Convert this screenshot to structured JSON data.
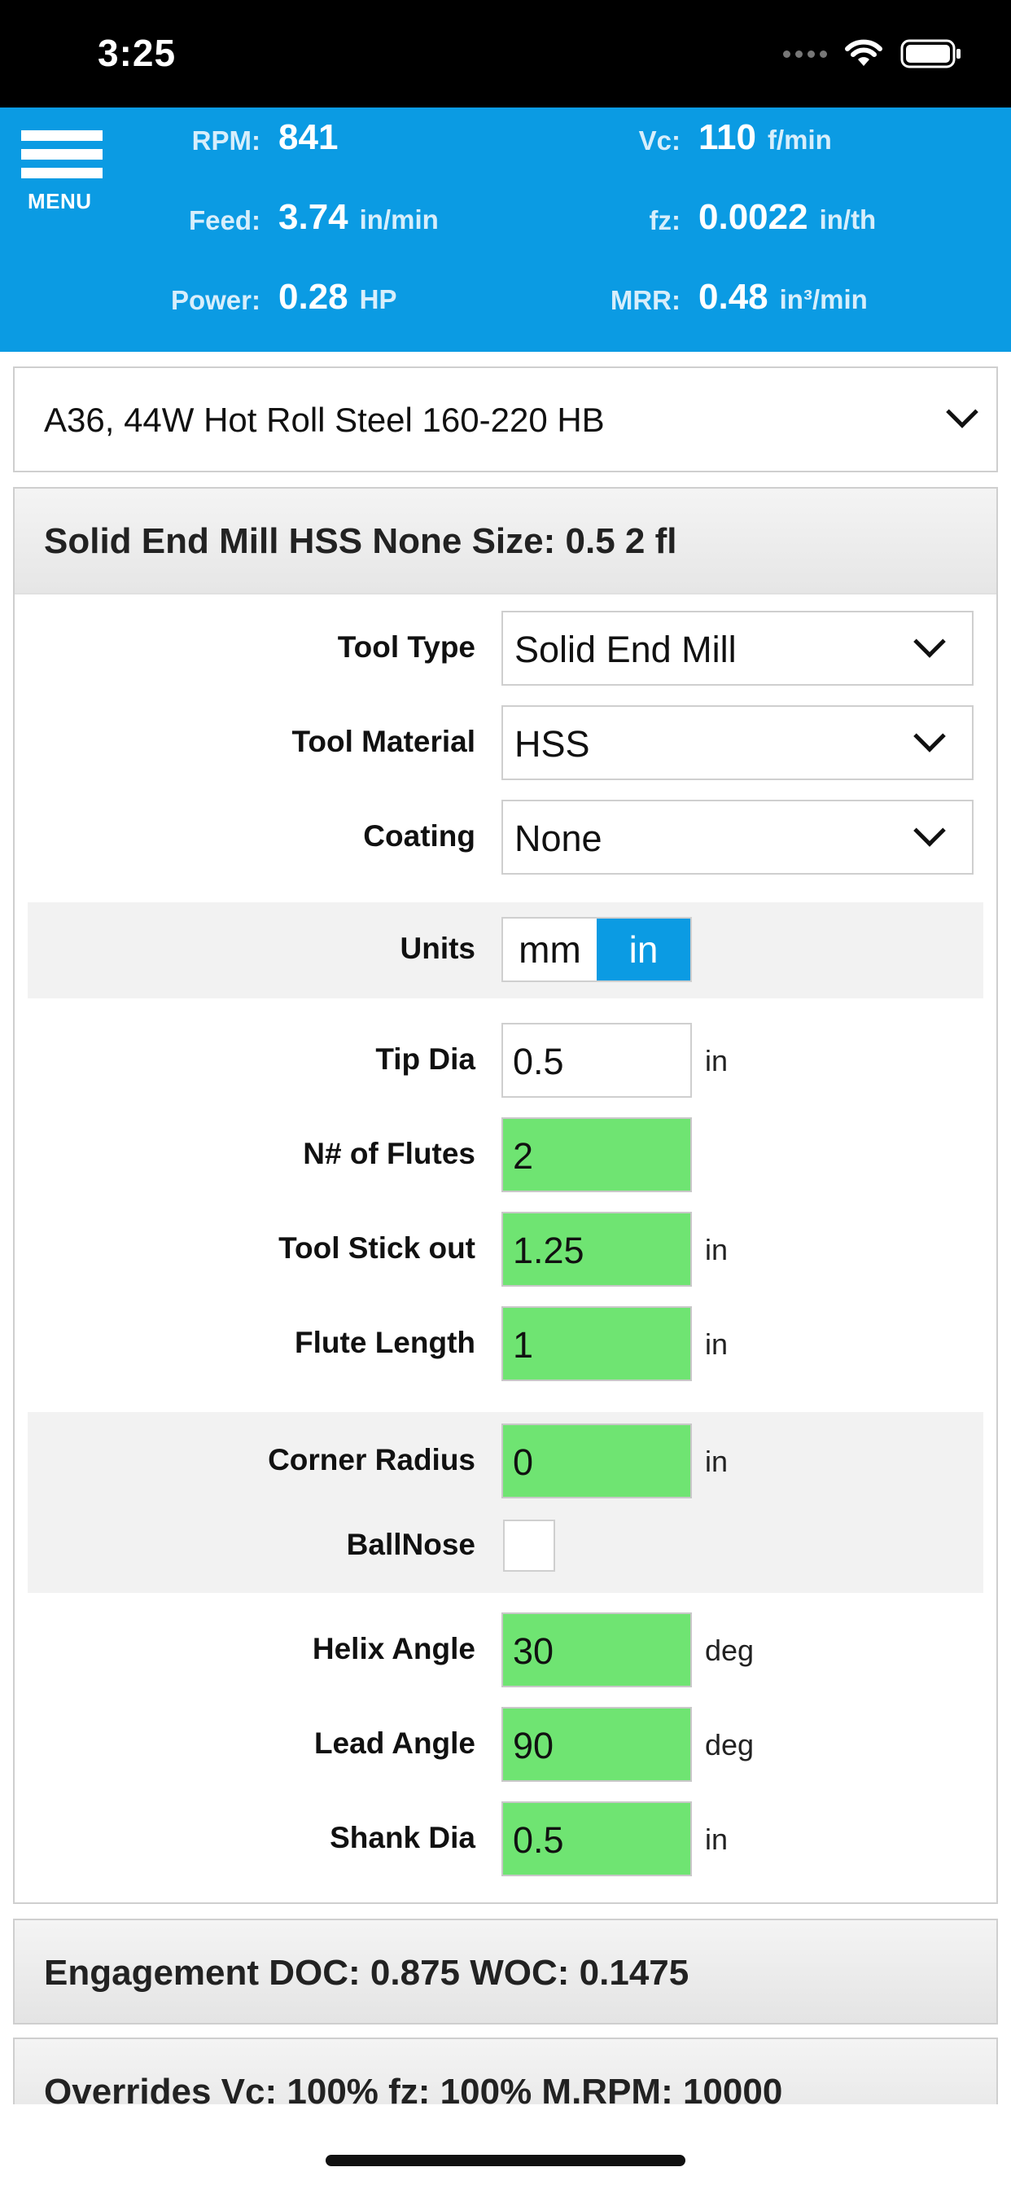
{
  "status_bar": {
    "time": "3:25"
  },
  "header": {
    "menu_label": "MENU",
    "metrics": {
      "rpm": {
        "label": "RPM:",
        "value": "841",
        "unit": ""
      },
      "vc": {
        "label": "Vc:",
        "value": "110",
        "unit": "f/min"
      },
      "feed": {
        "label": "Feed:",
        "value": "3.74",
        "unit": "in/min"
      },
      "fz": {
        "label": "fz:",
        "value": "0.0022",
        "unit": "in/th"
      },
      "power": {
        "label": "Power:",
        "value": "0.28",
        "unit": "HP"
      },
      "mrr": {
        "label": "MRR:",
        "value": "0.48",
        "unit": "in³/min"
      }
    }
  },
  "material": {
    "selected": "A36, 44W Hot Roll Steel 160-220 HB"
  },
  "tool": {
    "title": "Solid End Mill HSS None Size: 0.5 2 fl",
    "tool_type": {
      "label": "Tool Type",
      "value": "Solid End Mill"
    },
    "tool_material": {
      "label": "Tool Material",
      "value": "HSS"
    },
    "coating": {
      "label": "Coating",
      "value": "None"
    },
    "units": {
      "label": "Units",
      "options": [
        "mm",
        "in"
      ],
      "selected": "in"
    },
    "tip_dia": {
      "label": "Tip Dia",
      "value": "0.5",
      "unit": "in"
    },
    "flutes": {
      "label": "N# of Flutes",
      "value": "2"
    },
    "stick_out": {
      "label": "Tool Stick out",
      "value": "1.25",
      "unit": "in"
    },
    "flute_length": {
      "label": "Flute Length",
      "value": "1",
      "unit": "in"
    },
    "corner_radius": {
      "label": "Corner Radius",
      "value": "0",
      "unit": "in"
    },
    "ballnose": {
      "label": "BallNose",
      "checked": false
    },
    "helix_angle": {
      "label": "Helix Angle",
      "value": "30",
      "unit": "deg"
    },
    "lead_angle": {
      "label": "Lead Angle",
      "value": "90",
      "unit": "deg"
    },
    "shank_dia": {
      "label": "Shank Dia",
      "value": "0.5",
      "unit": "in"
    }
  },
  "engagement": {
    "title": "Engagement DOC: 0.875 WOC: 0.1475"
  },
  "overrides": {
    "title": "Overrides Vc: 100% fz: 100% M.RPM: 10000"
  },
  "colors": {
    "accent": "#0b9be3",
    "field_highlight": "#6fe472"
  }
}
